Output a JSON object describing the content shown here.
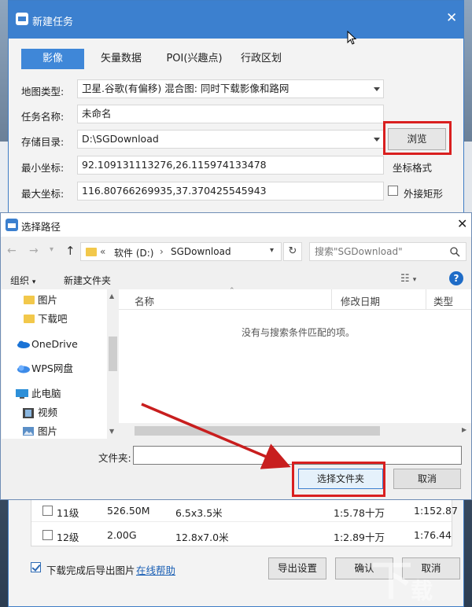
{
  "task_dialog": {
    "title": "新建任务",
    "close": "✕",
    "tabs": [
      "影像",
      "矢量数据",
      "POI(兴趣点)",
      "行政区划"
    ],
    "map_type_label": "地图类型:",
    "map_type_value": "卫星.谷歌(有偏移)  混合图: 同时下载影像和路网",
    "task_name_label": "任务名称:",
    "task_name_value": "未命名",
    "save_dir_label": "存储目录:",
    "save_dir_value": "D:\\SGDownload",
    "browse_label": "浏览",
    "min_coord_label": "最小坐标:",
    "min_coord_value": "92.109131113276,26.115974133478",
    "coord_format_label": "坐标格式",
    "max_coord_label": "最大坐标:",
    "max_coord_value": "116.80766269935,37.370425545943",
    "bbox_label": "外接矩形"
  },
  "levels": [
    {
      "level": "11级",
      "size": "526.50M",
      "dim": "6.5x3.5米",
      "scale1": "1:5.78十万",
      "scale2": "1:152.87"
    },
    {
      "level": "12级",
      "size": "2.00G",
      "dim": "12.8x7.0米",
      "scale1": "1:2.89十万",
      "scale2": "1:76.44"
    }
  ],
  "footer": {
    "export_after_label": "下载完成后导出图片",
    "help_link": "在线帮助",
    "export_settings": "导出设置",
    "ok": "确认",
    "cancel": "取消"
  },
  "file_dialog": {
    "title": "选择路径",
    "breadcrumb": [
      "软件 (D:)",
      "SGDownload"
    ],
    "search_placeholder": "搜索\"SGDownload\"",
    "organize": "组织",
    "new_folder": "新建文件夹",
    "nav_items": [
      "图片",
      "下载吧",
      "OneDrive",
      "WPS网盘",
      "此电脑",
      "视频",
      "图片"
    ],
    "columns": [
      "名称",
      "修改日期",
      "类型"
    ],
    "empty_message": "没有与搜索条件匹配的项。",
    "folder_label": "文件夹:",
    "folder_value": "",
    "select_folder": "选择文件夹",
    "cancel": "取消"
  },
  "colors": {
    "accent": "#3c80cf",
    "highlight": "#d91f1f",
    "arrow": "#c81e1e"
  }
}
